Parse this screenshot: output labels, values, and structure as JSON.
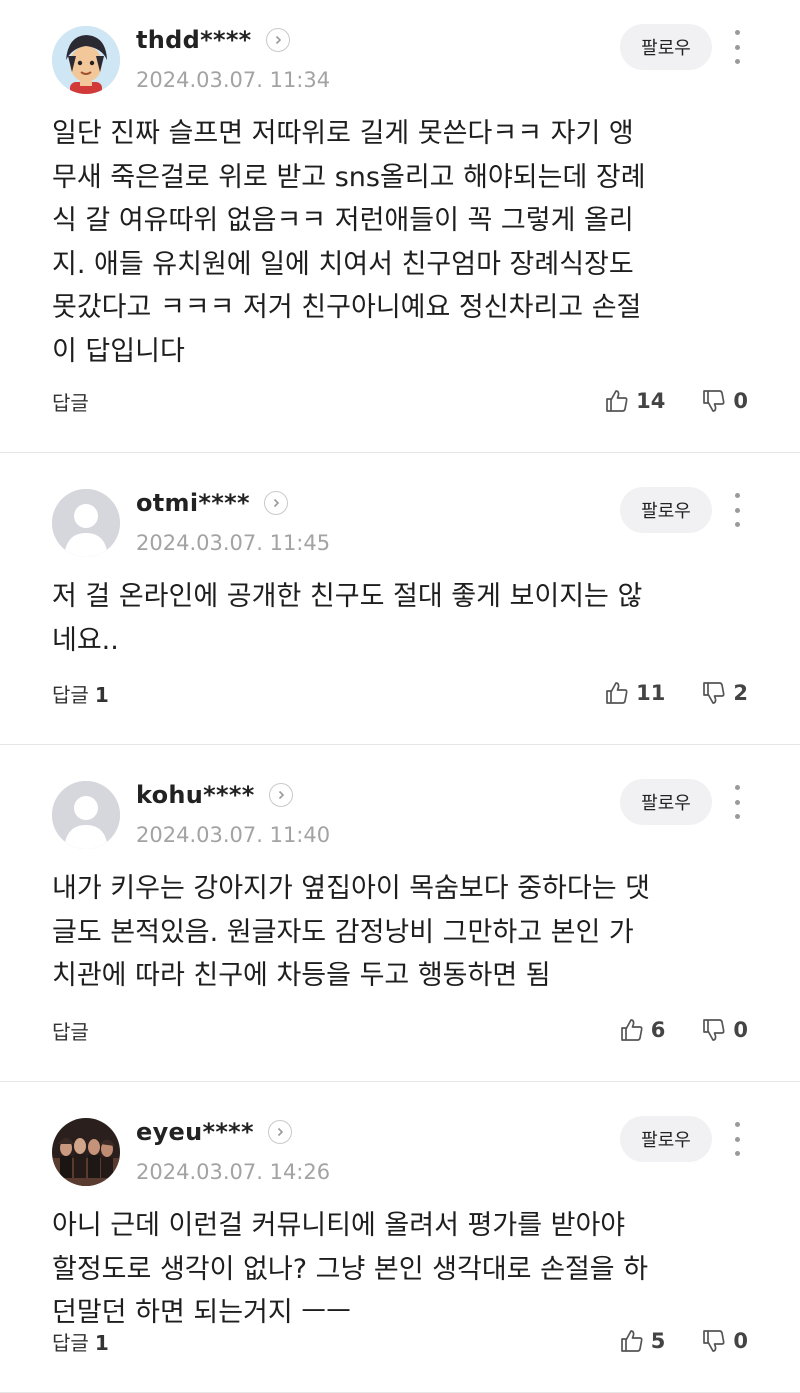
{
  "follow_label": "팔로우",
  "reply_label": "답글",
  "comments": [
    {
      "username": "thdd****",
      "date": "2024.03.07. 11:34",
      "lines": [
        "일단 진짜 슬프면 저따위로 길게 못쓴다ㅋㅋ 자기 앵",
        "무새 죽은걸로 위로 받고 sns올리고 해야되는데 장례",
        "식 갈 여유따위 없음ㅋㅋ 저런애들이 꼭 그렇게 올리",
        "지. 애들 유치원에 일에 치여서 친구엄마 장례식장도",
        "못갔다고 ㅋㅋㅋ 저거 친구아니예요 정신차리고 손절",
        "이 답입니다"
      ],
      "reply_count": "",
      "likes": "14",
      "dislikes": "0",
      "avatar": "cartoon-avatar"
    },
    {
      "username": "otmi****",
      "date": "2024.03.07. 11:45",
      "lines": [
        "저 걸 온라인에 공개한 친구도 절대 좋게 보이지는 않",
        "네요.."
      ],
      "reply_count": "1",
      "likes": "11",
      "dislikes": "2",
      "avatar": "default-avatar"
    },
    {
      "username": "kohu****",
      "date": "2024.03.07. 11:40",
      "lines": [
        "내가 키우는 강아지가 옆집아이 목숨보다 중하다는 댓",
        "글도 본적있음. 원글자도 감정낭비 그만하고 본인 가",
        "치관에 따라 친구에 차등을 두고 행동하면 됨"
      ],
      "reply_count": "",
      "likes": "6",
      "dislikes": "0",
      "avatar": "default-avatar"
    },
    {
      "username": "eyeu****",
      "date": "2024.03.07. 14:26",
      "lines": [
        "아니 근데 이런걸 커뮤니티에 올려서 평가를 받아야",
        "할정도로 생각이 없나? 그냥 본인 생각대로 손절을 하",
        "던말던 하면 되는거지 ㅡㅡ"
      ],
      "reply_count": "1",
      "likes": "5",
      "dislikes": "0",
      "avatar": "band-photo-avatar"
    }
  ]
}
